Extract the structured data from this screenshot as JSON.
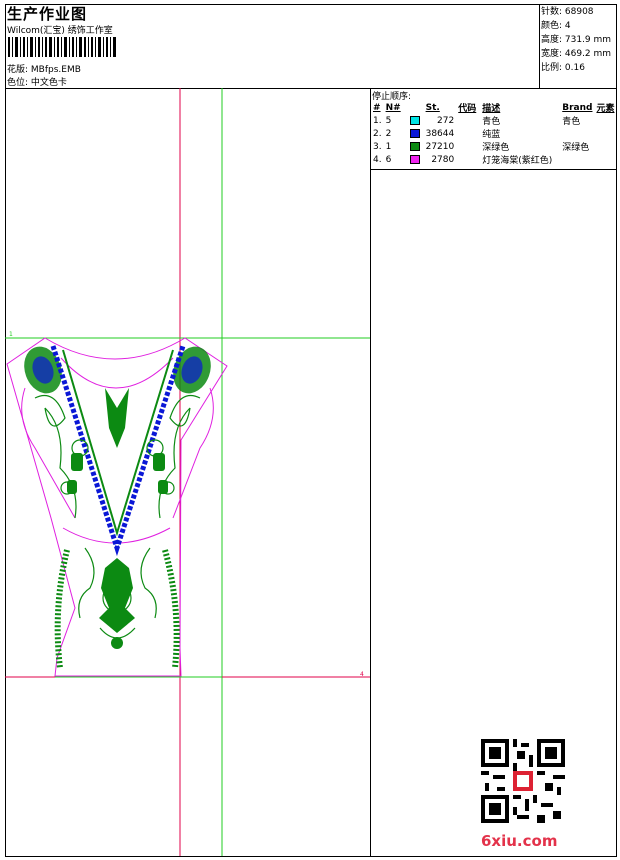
{
  "header": {
    "title": "生产作业图",
    "subtitle": "Wilcom(汇宝) 绣饰工作室",
    "pattern_label": "花版:",
    "pattern_value": "MBfps.EMB",
    "color_label": "色位:",
    "color_value": "中文色卡"
  },
  "stats": {
    "stitches": "针数: 68908",
    "colors": "颜色: 4",
    "height": "高度: 731.9 mm",
    "width": "宽度: 469.2 mm",
    "scale": "比例: 0.16"
  },
  "stop_sequence": {
    "title": "停止顺序:",
    "headers": [
      "#",
      "N#",
      "",
      "St.",
      "代码",
      "描述",
      "Brand",
      "元素"
    ],
    "rows": [
      {
        "num": "1.",
        "n": "5",
        "color": "#00e5e5",
        "stitches": "272",
        "code": "",
        "desc": "青色",
        "brand": "青色",
        "element": ""
      },
      {
        "num": "2.",
        "n": "2",
        "color": "#0a17d6",
        "stitches": "38644",
        "code": "",
        "desc": "纯蓝",
        "brand": "",
        "element": ""
      },
      {
        "num": "3.",
        "n": "1",
        "color": "#0c8a12",
        "stitches": "27210",
        "code": "",
        "desc": "深绿色",
        "brand": "深绿色",
        "element": ""
      },
      {
        "num": "4.",
        "n": "6",
        "color": "#ee22ee",
        "stitches": "2780",
        "code": "",
        "desc": "灯笼海棠(紫红色)",
        "brand": "",
        "element": ""
      }
    ]
  },
  "watermark": {
    "site": "6xiu.com"
  },
  "colors": {
    "guide_red": "#e0004a",
    "guide_green": "#22cc22",
    "outline_magenta": "#e020e0",
    "fill_green": "#0c8a12",
    "blue": "#0a17d6"
  }
}
